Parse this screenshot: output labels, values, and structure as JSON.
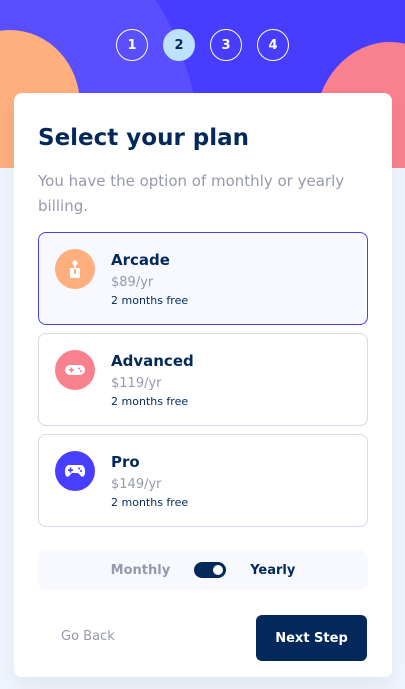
{
  "colors": {
    "marine_blue": "#02295a",
    "purplish_blue": "#473dff",
    "light_orange": "#ffaf7e",
    "pastel_pink": "#f9818e",
    "light_blue": "#bee2fd",
    "cool_gray": "#9699ab"
  },
  "steps": [
    {
      "number": "1",
      "active": false
    },
    {
      "number": "2",
      "active": true
    },
    {
      "number": "3",
      "active": false
    },
    {
      "number": "4",
      "active": false
    }
  ],
  "form": {
    "title": "Select your plan",
    "subtitle": "You have the option of monthly or yearly billing."
  },
  "plans": [
    {
      "name": "Arcade",
      "price": "$89/yr",
      "promo": "2 months free",
      "icon": "arcade-joystick-icon",
      "color": "#ffaf7e",
      "selected": true
    },
    {
      "name": "Advanced",
      "price": "$119/yr",
      "promo": "2 months free",
      "icon": "gamepad-icon",
      "color": "#f9818e",
      "selected": false
    },
    {
      "name": "Pro",
      "price": "$149/yr",
      "promo": "2 months free",
      "icon": "controller-icon",
      "color": "#483eff",
      "selected": false
    }
  ],
  "billing": {
    "monthly_label": "Monthly",
    "yearly_label": "Yearly",
    "selected": "Yearly"
  },
  "actions": {
    "back_label": "Go Back",
    "next_label": "Next Step"
  }
}
